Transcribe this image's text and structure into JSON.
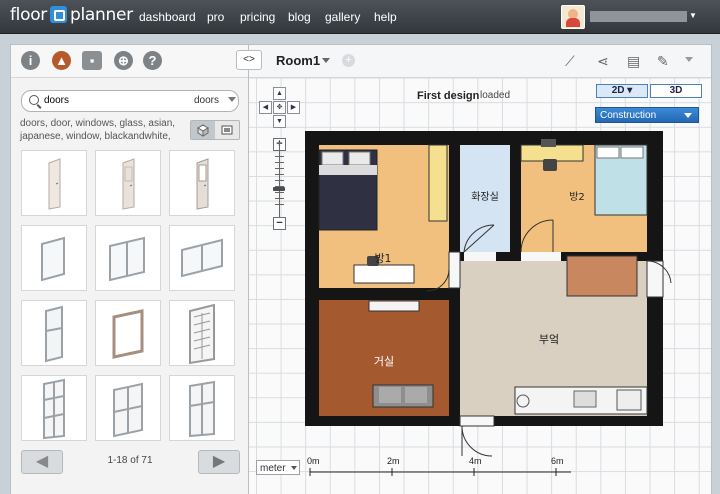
{
  "nav": {
    "logo_left": "floor",
    "logo_right": "planner",
    "links": [
      "dashboard",
      "pro",
      "pricing",
      "blog",
      "gallery",
      "help"
    ]
  },
  "library": {
    "search_value": "doors",
    "category": "doors",
    "tags": "doors, door, windows, glass, asian, japanese, window, blackandwhite,",
    "pagination": "1-18 of 71",
    "prev_icon": "arrow-left-icon",
    "next_icon": "arrow-right-icon"
  },
  "canvas": {
    "room_name": "Room1",
    "design_title": "First design",
    "design_status": "loaded",
    "view_2d": "2D",
    "view_3d": "3D",
    "mode": "Construction",
    "unit": "meter",
    "scale_labels": [
      "0m",
      "2m",
      "4m",
      "6m"
    ]
  },
  "plan": {
    "rooms": [
      "방1",
      "화장실",
      "방2",
      "거실",
      "부엌"
    ],
    "colors": {
      "wall": "#151515",
      "bedroom": "#f2c07e",
      "bathroom": "#d4e4f2",
      "living": "#a45a2e",
      "kitchen": "#d9d0c2"
    }
  }
}
